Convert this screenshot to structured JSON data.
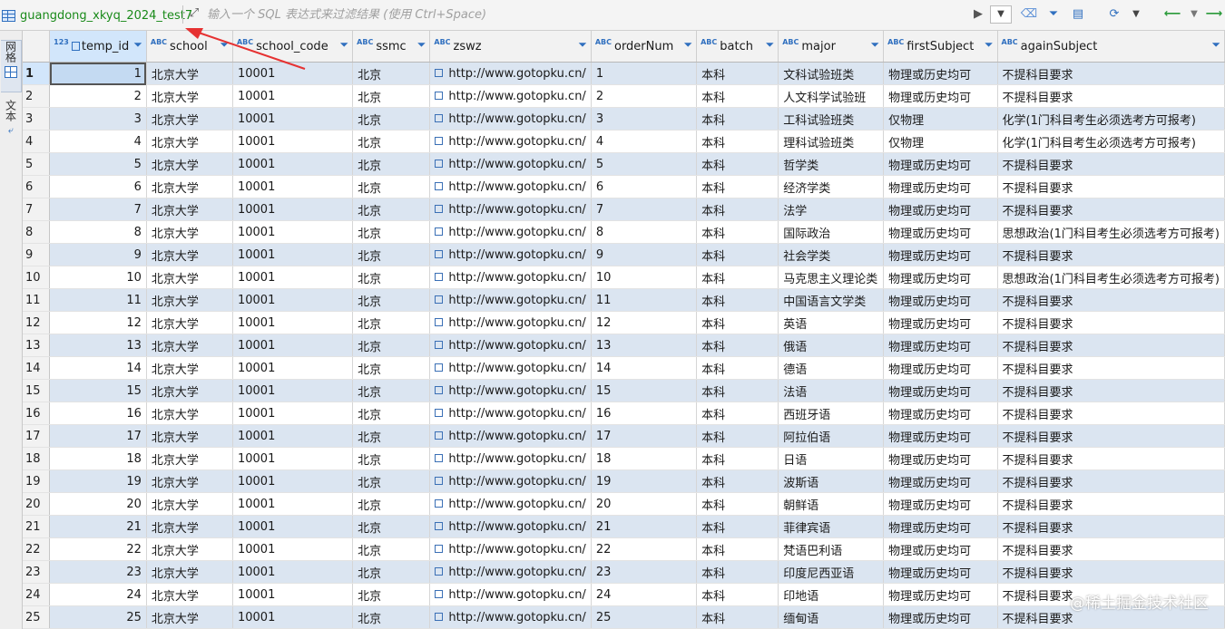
{
  "toolbar": {
    "table_name": "guangdong_xkyq_2024_test7",
    "filter_placeholder": "输入一个 SQL 表达式来过滤结果 (使用 Ctrl+Space)",
    "icons": [
      "expand-icon",
      "play-icon",
      "history-dropdown-icon",
      "eraser-icon",
      "filter-icon",
      "save-filter-icon",
      "refresh-icon",
      "refresh-dropdown-icon",
      "back-arrow-icon",
      "back-dropdown-icon",
      "forward-arrow-icon"
    ]
  },
  "side_tabs": {
    "grid": "网格",
    "text": "文本"
  },
  "accent": {
    "table_name_color": "#1a8a1a",
    "row_stripe": "#dbe5f1",
    "arrow": "#e63232"
  },
  "columns": [
    {
      "name": "temp_id",
      "type": "123"
    },
    {
      "name": "school",
      "type": "ABC"
    },
    {
      "name": "school_code",
      "type": "ABC"
    },
    {
      "name": "ssmc",
      "type": "ABC"
    },
    {
      "name": "zswz",
      "type": "ABC"
    },
    {
      "name": "orderNum",
      "type": "ABC"
    },
    {
      "name": "batch",
      "type": "ABC"
    },
    {
      "name": "major",
      "type": "ABC"
    },
    {
      "name": "firstSubject",
      "type": "ABC"
    },
    {
      "name": "againSubject",
      "type": "ABC"
    }
  ],
  "rows": [
    {
      "n": "1",
      "temp_id": "1",
      "school": "北京大学",
      "school_code": "10001",
      "ssmc": "北京",
      "zswz": "http://www.gotopku.cn/",
      "orderNum": "1",
      "batch": "本科",
      "major": "文科试验班类",
      "firstSubject": "物理或历史均可",
      "againSubject": "不提科目要求"
    },
    {
      "n": "2",
      "temp_id": "2",
      "school": "北京大学",
      "school_code": "10001",
      "ssmc": "北京",
      "zswz": "http://www.gotopku.cn/",
      "orderNum": "2",
      "batch": "本科",
      "major": "人文科学试验班",
      "firstSubject": "物理或历史均可",
      "againSubject": "不提科目要求"
    },
    {
      "n": "3",
      "temp_id": "3",
      "school": "北京大学",
      "school_code": "10001",
      "ssmc": "北京",
      "zswz": "http://www.gotopku.cn/",
      "orderNum": "3",
      "batch": "本科",
      "major": "工科试验班类",
      "firstSubject": "仅物理",
      "againSubject": "化学(1门科目考生必须选考方可报考)"
    },
    {
      "n": "4",
      "temp_id": "4",
      "school": "北京大学",
      "school_code": "10001",
      "ssmc": "北京",
      "zswz": "http://www.gotopku.cn/",
      "orderNum": "4",
      "batch": "本科",
      "major": "理科试验班类",
      "firstSubject": "仅物理",
      "againSubject": "化学(1门科目考生必须选考方可报考)"
    },
    {
      "n": "5",
      "temp_id": "5",
      "school": "北京大学",
      "school_code": "10001",
      "ssmc": "北京",
      "zswz": "http://www.gotopku.cn/",
      "orderNum": "5",
      "batch": "本科",
      "major": "哲学类",
      "firstSubject": "物理或历史均可",
      "againSubject": "不提科目要求"
    },
    {
      "n": "6",
      "temp_id": "6",
      "school": "北京大学",
      "school_code": "10001",
      "ssmc": "北京",
      "zswz": "http://www.gotopku.cn/",
      "orderNum": "6",
      "batch": "本科",
      "major": "经济学类",
      "firstSubject": "物理或历史均可",
      "againSubject": "不提科目要求"
    },
    {
      "n": "7",
      "temp_id": "7",
      "school": "北京大学",
      "school_code": "10001",
      "ssmc": "北京",
      "zswz": "http://www.gotopku.cn/",
      "orderNum": "7",
      "batch": "本科",
      "major": "法学",
      "firstSubject": "物理或历史均可",
      "againSubject": "不提科目要求"
    },
    {
      "n": "8",
      "temp_id": "8",
      "school": "北京大学",
      "school_code": "10001",
      "ssmc": "北京",
      "zswz": "http://www.gotopku.cn/",
      "orderNum": "8",
      "batch": "本科",
      "major": "国际政治",
      "firstSubject": "物理或历史均可",
      "againSubject": "思想政治(1门科目考生必须选考方可报考)"
    },
    {
      "n": "9",
      "temp_id": "9",
      "school": "北京大学",
      "school_code": "10001",
      "ssmc": "北京",
      "zswz": "http://www.gotopku.cn/",
      "orderNum": "9",
      "batch": "本科",
      "major": "社会学类",
      "firstSubject": "物理或历史均可",
      "againSubject": "不提科目要求"
    },
    {
      "n": "10",
      "temp_id": "10",
      "school": "北京大学",
      "school_code": "10001",
      "ssmc": "北京",
      "zswz": "http://www.gotopku.cn/",
      "orderNum": "10",
      "batch": "本科",
      "major": "马克思主义理论类",
      "firstSubject": "物理或历史均可",
      "againSubject": "思想政治(1门科目考生必须选考方可报考)"
    },
    {
      "n": "11",
      "temp_id": "11",
      "school": "北京大学",
      "school_code": "10001",
      "ssmc": "北京",
      "zswz": "http://www.gotopku.cn/",
      "orderNum": "11",
      "batch": "本科",
      "major": "中国语言文学类",
      "firstSubject": "物理或历史均可",
      "againSubject": "不提科目要求"
    },
    {
      "n": "12",
      "temp_id": "12",
      "school": "北京大学",
      "school_code": "10001",
      "ssmc": "北京",
      "zswz": "http://www.gotopku.cn/",
      "orderNum": "12",
      "batch": "本科",
      "major": "英语",
      "firstSubject": "物理或历史均可",
      "againSubject": "不提科目要求"
    },
    {
      "n": "13",
      "temp_id": "13",
      "school": "北京大学",
      "school_code": "10001",
      "ssmc": "北京",
      "zswz": "http://www.gotopku.cn/",
      "orderNum": "13",
      "batch": "本科",
      "major": "俄语",
      "firstSubject": "物理或历史均可",
      "againSubject": "不提科目要求"
    },
    {
      "n": "14",
      "temp_id": "14",
      "school": "北京大学",
      "school_code": "10001",
      "ssmc": "北京",
      "zswz": "http://www.gotopku.cn/",
      "orderNum": "14",
      "batch": "本科",
      "major": "德语",
      "firstSubject": "物理或历史均可",
      "againSubject": "不提科目要求"
    },
    {
      "n": "15",
      "temp_id": "15",
      "school": "北京大学",
      "school_code": "10001",
      "ssmc": "北京",
      "zswz": "http://www.gotopku.cn/",
      "orderNum": "15",
      "batch": "本科",
      "major": "法语",
      "firstSubject": "物理或历史均可",
      "againSubject": "不提科目要求"
    },
    {
      "n": "16",
      "temp_id": "16",
      "school": "北京大学",
      "school_code": "10001",
      "ssmc": "北京",
      "zswz": "http://www.gotopku.cn/",
      "orderNum": "16",
      "batch": "本科",
      "major": "西班牙语",
      "firstSubject": "物理或历史均可",
      "againSubject": "不提科目要求"
    },
    {
      "n": "17",
      "temp_id": "17",
      "school": "北京大学",
      "school_code": "10001",
      "ssmc": "北京",
      "zswz": "http://www.gotopku.cn/",
      "orderNum": "17",
      "batch": "本科",
      "major": "阿拉伯语",
      "firstSubject": "物理或历史均可",
      "againSubject": "不提科目要求"
    },
    {
      "n": "18",
      "temp_id": "18",
      "school": "北京大学",
      "school_code": "10001",
      "ssmc": "北京",
      "zswz": "http://www.gotopku.cn/",
      "orderNum": "18",
      "batch": "本科",
      "major": "日语",
      "firstSubject": "物理或历史均可",
      "againSubject": "不提科目要求"
    },
    {
      "n": "19",
      "temp_id": "19",
      "school": "北京大学",
      "school_code": "10001",
      "ssmc": "北京",
      "zswz": "http://www.gotopku.cn/",
      "orderNum": "19",
      "batch": "本科",
      "major": "波斯语",
      "firstSubject": "物理或历史均可",
      "againSubject": "不提科目要求"
    },
    {
      "n": "20",
      "temp_id": "20",
      "school": "北京大学",
      "school_code": "10001",
      "ssmc": "北京",
      "zswz": "http://www.gotopku.cn/",
      "orderNum": "20",
      "batch": "本科",
      "major": "朝鲜语",
      "firstSubject": "物理或历史均可",
      "againSubject": "不提科目要求"
    },
    {
      "n": "21",
      "temp_id": "21",
      "school": "北京大学",
      "school_code": "10001",
      "ssmc": "北京",
      "zswz": "http://www.gotopku.cn/",
      "orderNum": "21",
      "batch": "本科",
      "major": "菲律宾语",
      "firstSubject": "物理或历史均可",
      "againSubject": "不提科目要求"
    },
    {
      "n": "22",
      "temp_id": "22",
      "school": "北京大学",
      "school_code": "10001",
      "ssmc": "北京",
      "zswz": "http://www.gotopku.cn/",
      "orderNum": "22",
      "batch": "本科",
      "major": "梵语巴利语",
      "firstSubject": "物理或历史均可",
      "againSubject": "不提科目要求"
    },
    {
      "n": "23",
      "temp_id": "23",
      "school": "北京大学",
      "school_code": "10001",
      "ssmc": "北京",
      "zswz": "http://www.gotopku.cn/",
      "orderNum": "23",
      "batch": "本科",
      "major": "印度尼西亚语",
      "firstSubject": "物理或历史均可",
      "againSubject": "不提科目要求"
    },
    {
      "n": "24",
      "temp_id": "24",
      "school": "北京大学",
      "school_code": "10001",
      "ssmc": "北京",
      "zswz": "http://www.gotopku.cn/",
      "orderNum": "24",
      "batch": "本科",
      "major": "印地语",
      "firstSubject": "物理或历史均可",
      "againSubject": "不提科目要求"
    },
    {
      "n": "25",
      "temp_id": "25",
      "school": "北京大学",
      "school_code": "10001",
      "ssmc": "北京",
      "zswz": "http://www.gotopku.cn/",
      "orderNum": "25",
      "batch": "本科",
      "major": "缅甸语",
      "firstSubject": "物理或历史均可",
      "againSubject": "不提科目要求"
    }
  ],
  "watermark": "@稀土掘金技术社区"
}
